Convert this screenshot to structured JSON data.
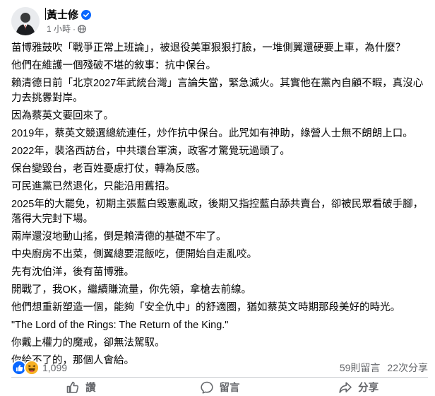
{
  "post": {
    "author": "黃士修",
    "timestamp": "1 小時",
    "separator": "·",
    "paragraphs": [
      "苗博雅鼓吹「戰爭正常上班論」，被退役美軍狠狠打臉，一堆側翼還硬要上車，為什麼？",
      "他們在維護一個殘破不堪的敘事：抗中保台。",
      "賴清德日前「北京2027年武統台灣」言論失當，緊急滅火。其實他在黨內自顧不暇，真沒心力去挑釁對岸。",
      "因為蔡英文要回來了。",
      "2019年，蔡英文競選總統連任，炒作抗中保台。此咒如有神助，綠營人士無不朗朗上口。",
      "2022年，裴洛西訪台，中共環台軍演，政客才驚覺玩過頭了。",
      "保台變毀台，老百姓憂慮打仗，轉為反感。",
      "可民進黨已然退化，只能沿用舊招。",
      "2025年的大罷免，初期主張藍白毀憲亂政，後期又指控藍白舔共賣台，卻被民眾看破手腳，落得大完封下場。",
      "兩岸還沒地動山搖，倒是賴清德的基礎不牢了。",
      "中央廚房不出菜，側翼總要混飯吃，便開始自走亂咬。",
      "先有沈伯洋，後有苗博雅。",
      "開戰了，我OK，繼續賺流量，你先領，拿槍去前線。",
      "他們想重新塑造一個，能夠「安全仇中」的舒適圈，猶如蔡英文時期那段美好的時光。",
      "\"The Lord of the Rings: The Return of the King.\"",
      "你戴上權力的魔戒，卻無法駕馭。",
      "你給不了的，那個人會給。"
    ]
  },
  "reactions": {
    "count": "1,099",
    "comments": "59則留言",
    "shares": "22次分享",
    "icons": [
      "like-icon",
      "haha-icon"
    ]
  },
  "actions": {
    "like_label": "讚",
    "comment_label": "留言",
    "share_label": "分享"
  },
  "colors": {
    "like_blue": "#0866ff",
    "haha_yellow": "#f7b125",
    "muted_text": "#65676b"
  }
}
